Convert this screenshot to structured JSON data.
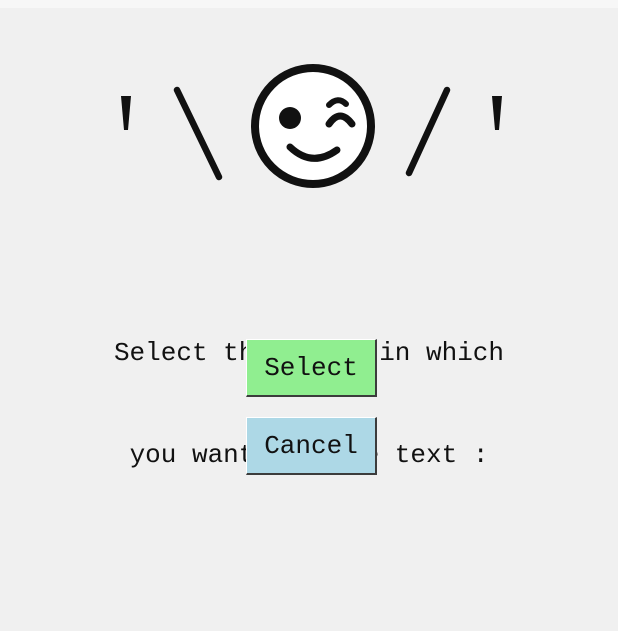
{
  "window": {
    "background": "#f0f0f0"
  },
  "header": {
    "emoticon_left": "' \\",
    "emoticon_icon": "winking-face-icon",
    "emoticon_right": "/ '"
  },
  "prompt": {
    "line1": "Select the Image in which",
    "line2": "you want to hide text :"
  },
  "buttons": {
    "select_label": "Select",
    "select_color": "#90ee90",
    "cancel_label": "Cancel",
    "cancel_color": "#add8e6"
  }
}
